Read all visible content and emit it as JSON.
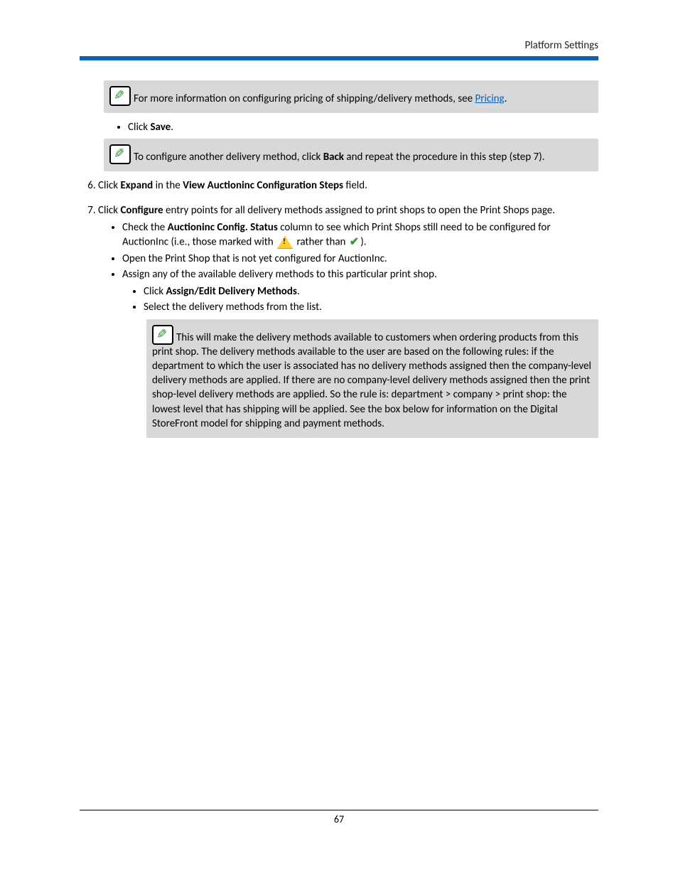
{
  "header": {
    "title": "Platform Settings"
  },
  "note1": {
    "prefix": "For more information on configuring pricing of shipping/delivery methods, see ",
    "link": "Pricing",
    "suffix": "."
  },
  "bullet_save": {
    "pre": "Click ",
    "bold": "Save",
    "post": "."
  },
  "note2": {
    "pre": "To configure another delivery method, click ",
    "bold": "Back",
    "post": " and repeat the procedure in this step (step 7)."
  },
  "step6": {
    "t1": "Click ",
    "b1": "Expand",
    "t2": " in the ",
    "b2": "View Auctioninc Configuration Steps",
    "t3": " field."
  },
  "step7": {
    "t1": "Click ",
    "b1": "Configure",
    "t2": " entry points for all delivery methods assigned to print shops to open the Print Shops page."
  },
  "step7a": {
    "t1": "Check the ",
    "b1": "Auctioninc Config. Status",
    "t2": " column to see which Print Shops still need to be configured for AuctionInc (i.e., those marked with ",
    "t3": " rather than ",
    "t4": ")."
  },
  "step7b": "Open the Print Shop that is not yet configured for AuctionInc.",
  "step7c": "Assign any of the available delivery methods to this particular print shop.",
  "step7c1": {
    "t1": "Click ",
    "b1": "Assign/Edit Delivery Methods",
    "t2": "."
  },
  "step7c2": "Select the delivery methods from the list.",
  "note3": "This will make the delivery methods available to customers when ordering products from this print shop. The delivery methods available to the user are based on the following rules: if the department to which the user is associated has no delivery methods assigned then the company-level delivery methods are applied. If there are no company-level delivery methods assigned then the print shop-level delivery methods are applied. So the rule is: department > company > print shop: the lowest level that has shipping will be applied. See the box below for information on the Digital StoreFront model for shipping and payment methods.",
  "footer": {
    "page": "67"
  }
}
